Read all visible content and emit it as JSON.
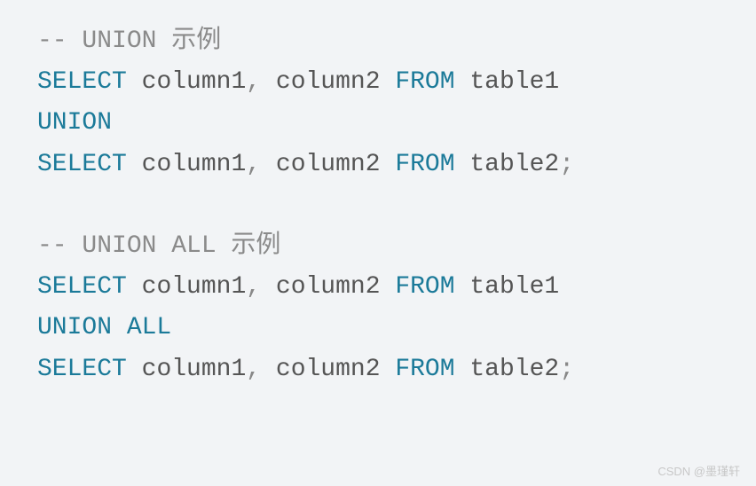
{
  "lines": [
    {
      "type": "comment",
      "prefix": "-- ",
      "text": "UNION 示例"
    },
    {
      "type": "stmt",
      "tokens": [
        {
          "kind": "keyword",
          "text": "SELECT"
        },
        {
          "kind": "space",
          "text": " "
        },
        {
          "kind": "ident",
          "text": "column1"
        },
        {
          "kind": "punct",
          "text": ","
        },
        {
          "kind": "space",
          "text": " "
        },
        {
          "kind": "ident",
          "text": "column2"
        },
        {
          "kind": "space",
          "text": " "
        },
        {
          "kind": "keyword",
          "text": "FROM"
        },
        {
          "kind": "space",
          "text": " "
        },
        {
          "kind": "ident",
          "text": "table1"
        }
      ]
    },
    {
      "type": "stmt",
      "tokens": [
        {
          "kind": "keyword",
          "text": "UNION"
        }
      ]
    },
    {
      "type": "stmt",
      "tokens": [
        {
          "kind": "keyword",
          "text": "SELECT"
        },
        {
          "kind": "space",
          "text": " "
        },
        {
          "kind": "ident",
          "text": "column1"
        },
        {
          "kind": "punct",
          "text": ","
        },
        {
          "kind": "space",
          "text": " "
        },
        {
          "kind": "ident",
          "text": "column2"
        },
        {
          "kind": "space",
          "text": " "
        },
        {
          "kind": "keyword",
          "text": "FROM"
        },
        {
          "kind": "space",
          "text": " "
        },
        {
          "kind": "ident",
          "text": "table2"
        },
        {
          "kind": "punct",
          "text": ";"
        }
      ]
    },
    {
      "type": "blank"
    },
    {
      "type": "comment",
      "prefix": "-- ",
      "text": "UNION ALL 示例"
    },
    {
      "type": "stmt",
      "tokens": [
        {
          "kind": "keyword",
          "text": "SELECT"
        },
        {
          "kind": "space",
          "text": " "
        },
        {
          "kind": "ident",
          "text": "column1"
        },
        {
          "kind": "punct",
          "text": ","
        },
        {
          "kind": "space",
          "text": " "
        },
        {
          "kind": "ident",
          "text": "column2"
        },
        {
          "kind": "space",
          "text": " "
        },
        {
          "kind": "keyword",
          "text": "FROM"
        },
        {
          "kind": "space",
          "text": " "
        },
        {
          "kind": "ident",
          "text": "table1"
        }
      ]
    },
    {
      "type": "stmt",
      "tokens": [
        {
          "kind": "keyword",
          "text": "UNION"
        },
        {
          "kind": "space",
          "text": " "
        },
        {
          "kind": "keyword",
          "text": "ALL"
        }
      ]
    },
    {
      "type": "stmt",
      "tokens": [
        {
          "kind": "keyword",
          "text": "SELECT"
        },
        {
          "kind": "space",
          "text": " "
        },
        {
          "kind": "ident",
          "text": "column1"
        },
        {
          "kind": "punct",
          "text": ","
        },
        {
          "kind": "space",
          "text": " "
        },
        {
          "kind": "ident",
          "text": "column2"
        },
        {
          "kind": "space",
          "text": " "
        },
        {
          "kind": "keyword",
          "text": "FROM"
        },
        {
          "kind": "space",
          "text": " "
        },
        {
          "kind": "ident",
          "text": "table2"
        },
        {
          "kind": "punct",
          "text": ";"
        }
      ]
    }
  ],
  "watermark": "CSDN @墨瑾轩"
}
